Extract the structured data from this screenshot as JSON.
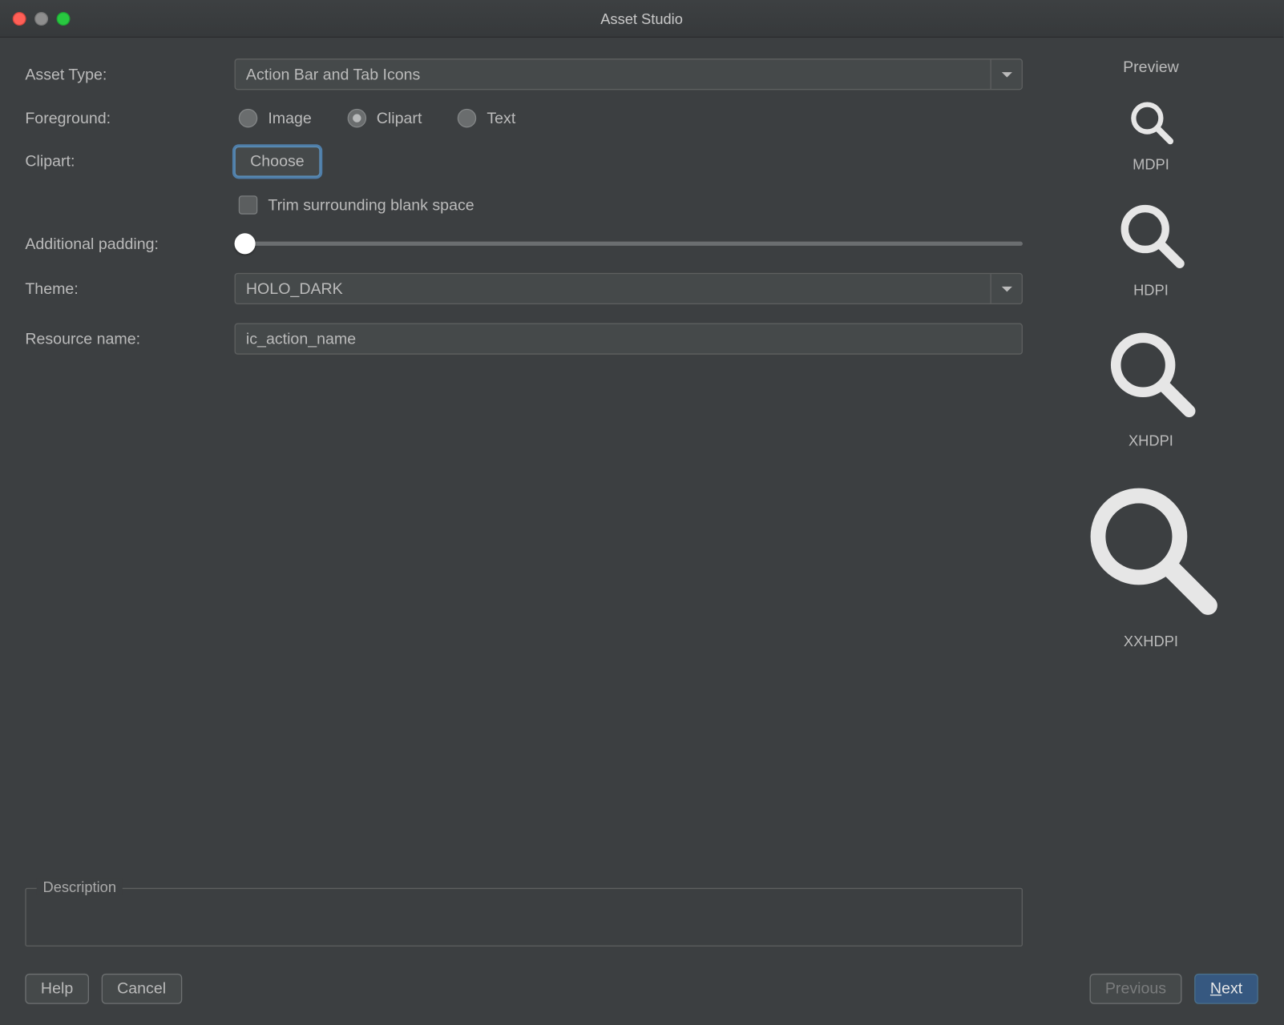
{
  "window": {
    "title": "Asset Studio"
  },
  "labels": {
    "asset_type": "Asset Type:",
    "foreground": "Foreground:",
    "clipart": "Clipart:",
    "additional_padding": "Additional padding:",
    "theme": "Theme:",
    "resource_name": "Resource name:"
  },
  "asset_type": {
    "value": "Action Bar and Tab Icons"
  },
  "foreground": {
    "options": {
      "image": "Image",
      "clipart": "Clipart",
      "text": "Text"
    },
    "selected": "Clipart"
  },
  "clipart": {
    "button": "Choose"
  },
  "trim": {
    "label": "Trim surrounding blank space",
    "checked": false
  },
  "padding": {
    "value": 0
  },
  "theme": {
    "value": "HOLO_DARK"
  },
  "resource_name": {
    "value": "ic_action_name"
  },
  "preview": {
    "title": "Preview",
    "sizes": {
      "mdpi": "MDPI",
      "hdpi": "HDPI",
      "xhdpi": "XHDPI",
      "xxhdpi": "XXHDPI"
    }
  },
  "description": {
    "legend": "Description",
    "text": ""
  },
  "footer": {
    "help": "Help",
    "cancel": "Cancel",
    "previous": "Previous",
    "next": "Next"
  }
}
